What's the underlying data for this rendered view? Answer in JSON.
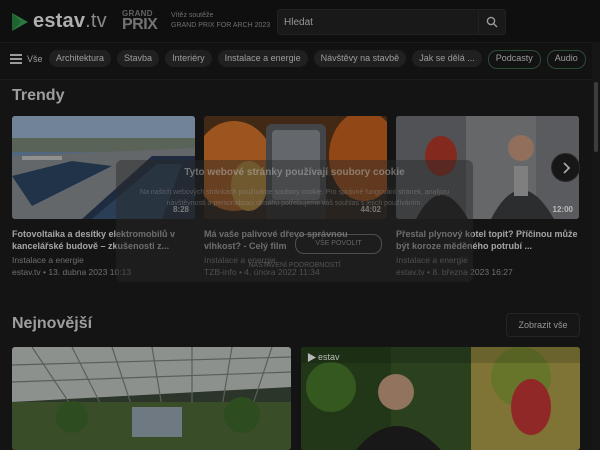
{
  "header": {
    "logo_text": "estav",
    "logo_suffix": ".tv",
    "grandprix_line1": "GRAND",
    "grandprix_line2": "PRIX",
    "grandprix_sub1": "Vítěz soutěže",
    "grandprix_sub2": "GRAND PRIX FOR ARCH 2023",
    "search_placeholder": "Hledat",
    "icons": {
      "search": "search-icon",
      "logo": "play-logo-icon"
    }
  },
  "nav": {
    "menu_label": "Vše",
    "categories": [
      "Architektura",
      "Stavba",
      "Interiéry",
      "Instalace a energie",
      "Návštěvy na stavbě",
      "Jak se dělá ..."
    ],
    "outlined": [
      "Podcasty",
      "Audio"
    ]
  },
  "trending": {
    "title": "Trendy",
    "cards": [
      {
        "title": "Fotovoltaika a desítky elektromobilů v kancelářské budově – zkušenosti z...",
        "category": "Instalace a energie",
        "meta": "estav.tv • 13. dubna 2023 10:13",
        "duration": "8:28"
      },
      {
        "title": "Má vaše palivové dřevo správnou vlhkost? - Celý film",
        "category": "Instalace a energie",
        "meta": "TZB-info • 4. února 2022 11:34",
        "duration": "44:02"
      },
      {
        "title": "Přestal plynový kotel topit? Příčinou může být koroze měděného potrubí ...",
        "category": "Instalace a energie",
        "meta": "estav.tv • 8. března 2023 16:27",
        "duration": "12:00"
      }
    ]
  },
  "latest": {
    "title": "Nejnovější",
    "show_all": "Zobrazit vše",
    "watermark": "estav"
  },
  "cookie": {
    "title": "Tyto webové stránky používají soubory cookie",
    "text": "Na našich webových stránkách používáme soubory cookie. Pro správné fungování stránek, analýzu návštěvnosti a personalizaci obsahu potřebujeme váš souhlas s jejich používáním.",
    "accept": "VŠE POVOLIT",
    "settings": "NASTAVENÍ PODROBNOSTÍ"
  },
  "colors": {
    "background": "#1c1c1c",
    "brand_green": "#3aa757",
    "chip": "#2d2d2d"
  }
}
